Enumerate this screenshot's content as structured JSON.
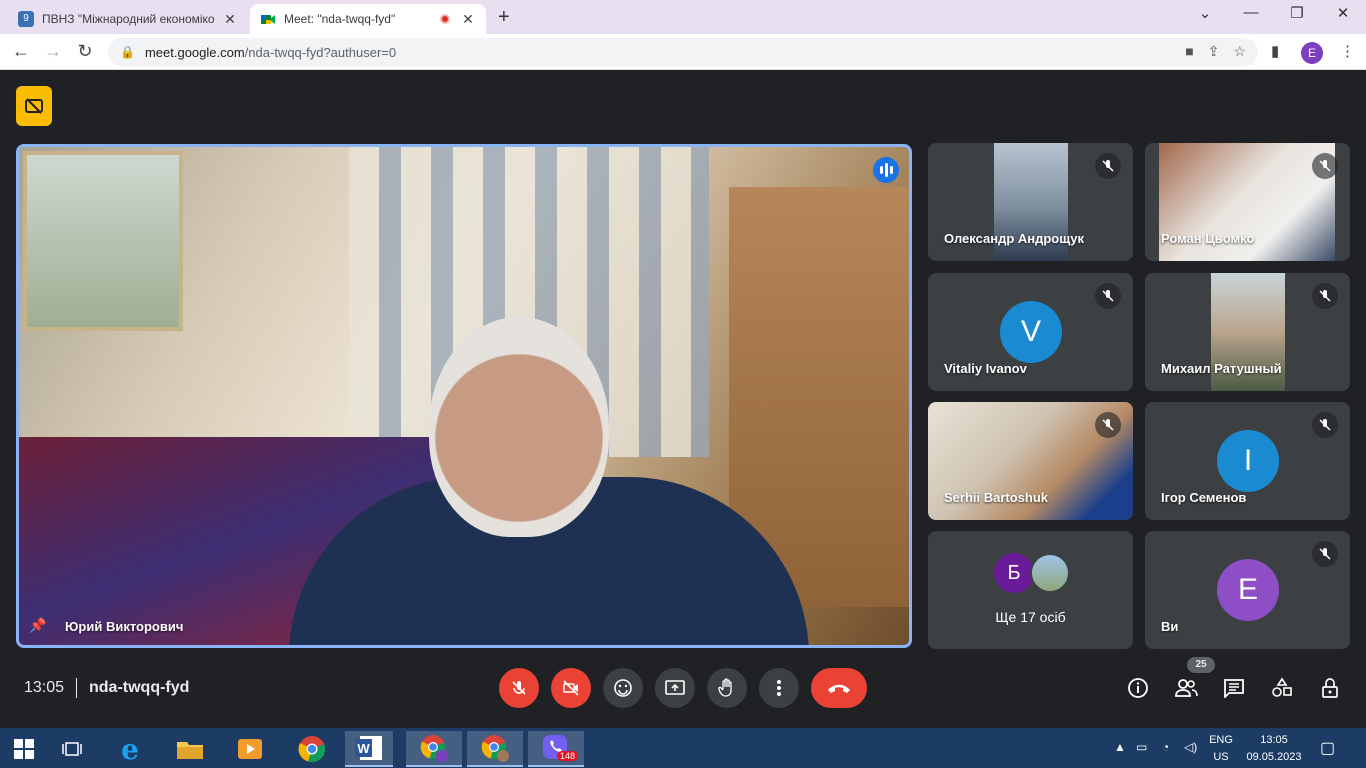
{
  "browser": {
    "tabs": [
      {
        "title": "ПВНЗ \"Міжнародний економіко",
        "favicon_color": "#3b6fb6",
        "favicon_label": "9"
      },
      {
        "title": "Meet: \"nda-twqq-fyd\"",
        "favicon_color": "#00832d"
      }
    ],
    "url_host": "meet.google.com",
    "url_path": "/nda-twqq-fyd?authuser=0",
    "profile_initial": "E"
  },
  "meet": {
    "main_speaker": "Юрий Викторович",
    "meeting_code": "nda-twqq-fyd",
    "time": "13:05",
    "participant_count": "25",
    "participants": [
      {
        "name": "Олександр Андрощук",
        "type": "video"
      },
      {
        "name": "Роман Цьомко",
        "type": "video"
      },
      {
        "name": "Vitaliy Ivanov",
        "type": "avatar",
        "initial": "V",
        "color": "#1a8bd1"
      },
      {
        "name": "Михаил Ратушный",
        "type": "video"
      },
      {
        "name": "Serhii Bartoshuk",
        "type": "video"
      },
      {
        "name": "Ігор Семенов",
        "type": "avatar",
        "initial": "I",
        "color": "#1a8bd1"
      },
      {
        "name": "Ви",
        "type": "avatar",
        "initial": "E",
        "color": "#8e4ec6"
      }
    ],
    "others_label": "Ще 17 осіб",
    "others_initial": "Б",
    "others_color": "#6a1b9a",
    "accent": "#8ab4f8",
    "danger": "#ea4335"
  },
  "taskbar": {
    "lang_top": "ENG",
    "lang_bottom": "US",
    "time": "13:05",
    "date": "09.05.2023",
    "viber_badge": "148"
  }
}
